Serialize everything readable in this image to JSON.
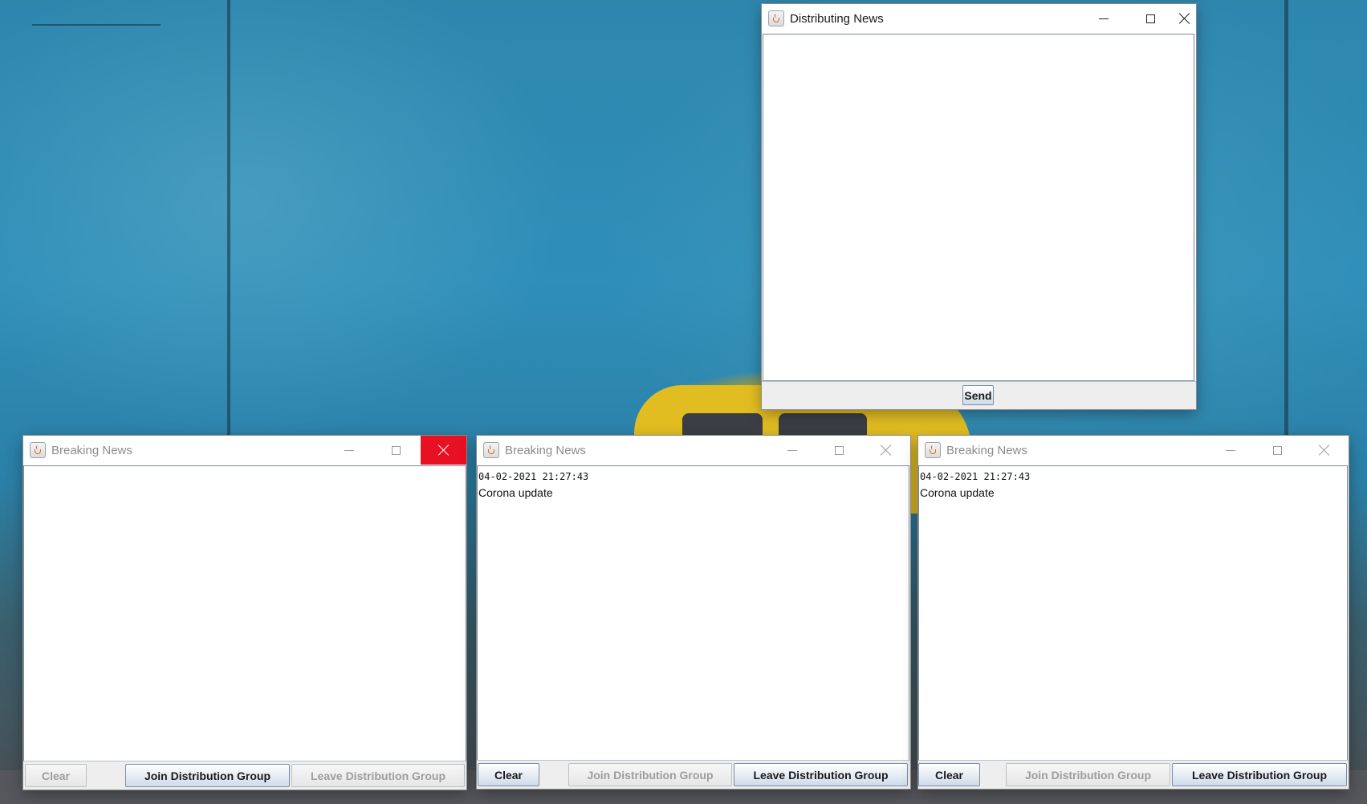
{
  "sender_window": {
    "title": "Distributing News",
    "send_label": "Send"
  },
  "receivers": [
    {
      "title": "Breaking News",
      "state": "inactive, close hovered",
      "messages": [],
      "clear_label": "Clear",
      "join_label": "Join Distribution Group",
      "leave_label": "Leave Distribution Group"
    },
    {
      "title": "Breaking News",
      "state": "inactive",
      "messages": [
        {
          "time": "04-02-2021 21:27:43",
          "text": "Corona update"
        }
      ],
      "clear_label": "Clear",
      "join_label": "Join Distribution Group",
      "leave_label": "Leave Distribution Group"
    },
    {
      "title": "Breaking News",
      "state": "inactive",
      "messages": [
        {
          "time": "04-02-2021 21:27:43",
          "text": "Corona update"
        }
      ],
      "clear_label": "Clear",
      "join_label": "Join Distribution Group",
      "leave_label": "Leave Distribution Group"
    }
  ],
  "colors": {
    "close_hover": "#e81123",
    "button_border": "#7a8ea4",
    "disabled_text": "#9d9d9d"
  }
}
